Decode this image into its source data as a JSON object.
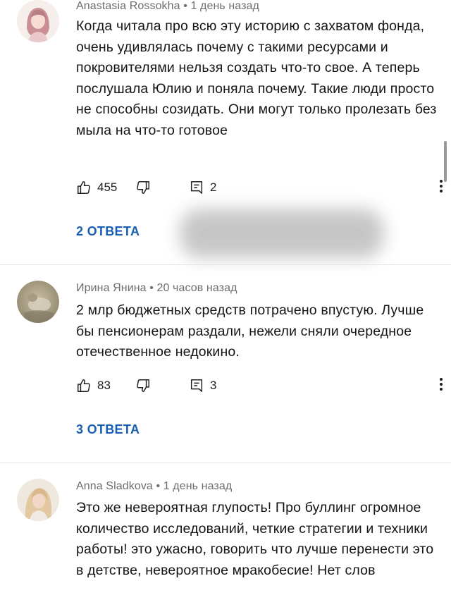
{
  "comments": [
    {
      "author": "Anastasia Rossokha",
      "sep": "•",
      "time": "1 день назад",
      "text": "Когда читала про всю эту историю с захватом фонда, очень удивлялась почему с такими ресурсами и покровителями нельзя создать что-то свое. А теперь послушала Юлию и поняла почему. Такие люди просто не способны созидать. Они могут только пролезать без мыла на что-то готовое",
      "likes": "455",
      "reply_count": "2",
      "replies_label": "2 ОТВЕТА"
    },
    {
      "author": "Ирина Янина",
      "sep": "•",
      "time": "20 часов назад",
      "text": "2 млр бюджетных средств потрачено впустую. Лучше бы пенсионерам раздали, нежели сняли очередное отечественное недокино.",
      "likes": "83",
      "reply_count": "3",
      "replies_label": "3 ОТВЕТА"
    },
    {
      "author": "Anna Sladkova",
      "sep": "•",
      "time": "1 день назад",
      "text": "Это же невероятная глупость! Про буллинг огромное количество исследований, четкие стратегии и техники работы! это ужасно, говорить что лучше перенести это в детстве, невероятное мракобесие! Нет слов"
    }
  ],
  "icons": {
    "like": "thumb-up-icon",
    "dislike": "thumb-down-icon",
    "comment": "comment-icon",
    "menu": "more-vert-icon"
  },
  "colors": {
    "link": "#1a5fb4",
    "meta": "#6d6d6d",
    "divider": "#e4e4e4"
  }
}
